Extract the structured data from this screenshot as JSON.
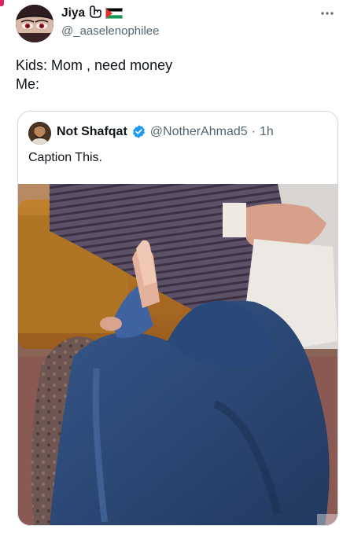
{
  "author": {
    "name": "Jiya",
    "handle": "@_aaselenophilee"
  },
  "tweet": {
    "lines": [
      "Kids: Mom , need money",
      "Me:"
    ]
  },
  "quoted_tweet": {
    "name": "Not Shafqat",
    "handle": "@NotherAhmad5",
    "separator": "·",
    "time": "1h",
    "text": "Caption This."
  },
  "icons": {
    "more": "more-horizontal-icon",
    "verified": "verified-badge-icon",
    "flag": "palestine-flag-icon",
    "hand": "hand-sign-icon"
  },
  "colors": {
    "text": "#0f1419",
    "secondary": "#536471",
    "border": "#cfd9de",
    "verified": "#1d9bf0"
  }
}
